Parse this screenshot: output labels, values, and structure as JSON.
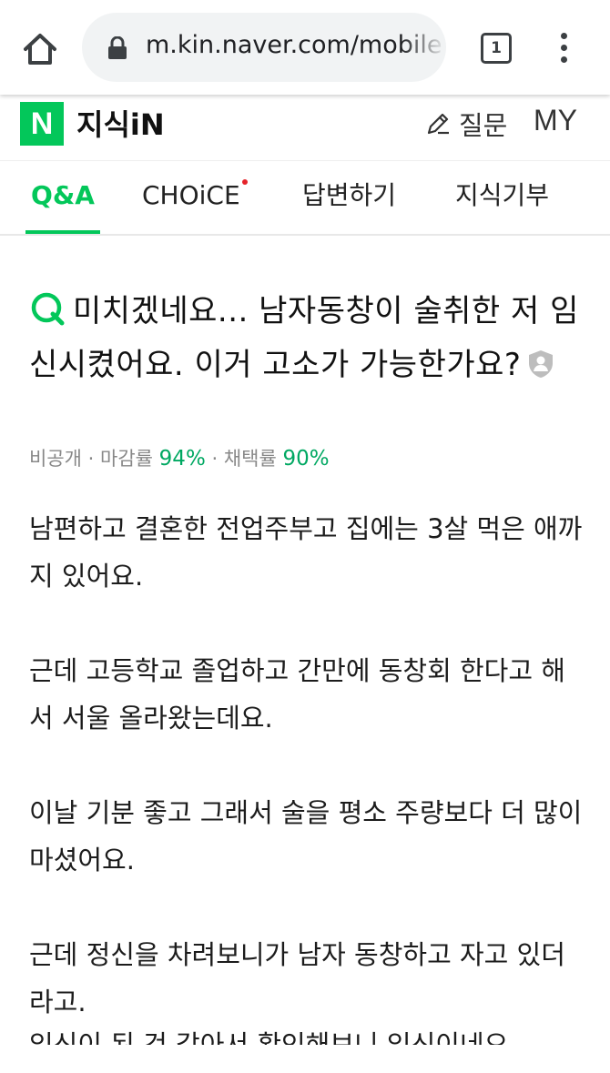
{
  "browser": {
    "url": "m.kin.naver.com/mobile",
    "tab_count": "1",
    "icons": {
      "home": "home-icon",
      "lock": "lock-icon",
      "menu": "more-vertical-icon"
    }
  },
  "header": {
    "logo_letter": "N",
    "logo_text": "지식iN",
    "ask_label": "질문",
    "my_label": "MY",
    "brand_color": "#03c75a"
  },
  "tabs": [
    {
      "label": "Q&A",
      "active": true
    },
    {
      "label": "CHOiCE",
      "has_dot": true
    },
    {
      "label": "답변하기"
    },
    {
      "label": "지식기부"
    }
  ],
  "question": {
    "title": "미치겠네요... 남자동창이 술취한 저 임신시켰어요. 이거 고소가 가능한가요?",
    "meta_private": "비공개",
    "meta_close_label": "마감률",
    "meta_close_value": "94%",
    "meta_adopt_label": "채택률",
    "meta_adopt_value": "90%"
  },
  "body": {
    "paragraphs": [
      "남편하고 결혼한 전업주부고 집에는 3살 먹은 애까지 있어요.",
      "근데 고등학교 졸업하고 간만에 동창회 한다고 해서 서울 올라왔는데요.",
      "이날 기분 좋고 그래서 술을 평소 주량보다 더 많이 마셨어요.",
      "근데 정신을 차려보니가 남자 동창하고 자고 있더라고."
    ],
    "cut_line": "임신이 된 것 같아서 확인해보니 임신이네요"
  }
}
